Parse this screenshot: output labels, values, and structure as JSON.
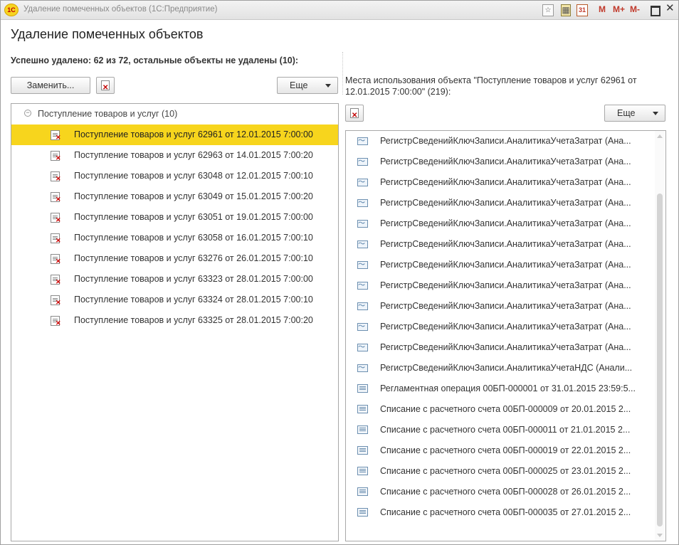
{
  "window": {
    "title": "Удаление помеченных объектов  (1С:Предприятие)",
    "app_logo": "1С",
    "toolbar": {
      "star_icon": "☆",
      "calculator_icon": "▦",
      "calendar_icon": "31",
      "m": "M",
      "m_plus": "M+",
      "m_minus": "M-",
      "close": "✕"
    }
  },
  "page": {
    "title": "Удаление помеченных объектов",
    "summary": "Успешно удалено: 62 из 72, остальные объекты не удалены (10):"
  },
  "left": {
    "replace_button": "Заменить...",
    "more_button": "Еще",
    "group": {
      "label": "Поступление товаров и услуг (10)",
      "collapse_icon": "−"
    },
    "items": [
      {
        "label": "Поступление товаров и услуг 62961 от 12.01.2015 7:00:00",
        "selected": true
      },
      {
        "label": "Поступление товаров и услуг 62963 от 14.01.2015 7:00:20",
        "selected": false
      },
      {
        "label": "Поступление товаров и услуг 63048 от 12.01.2015 7:00:10",
        "selected": false
      },
      {
        "label": "Поступление товаров и услуг 63049 от 15.01.2015 7:00:20",
        "selected": false
      },
      {
        "label": "Поступление товаров и услуг 63051 от 19.01.2015 7:00:00",
        "selected": false
      },
      {
        "label": "Поступление товаров и услуг 63058 от 16.01.2015 7:00:10",
        "selected": false
      },
      {
        "label": "Поступление товаров и услуг 63276 от 26.01.2015 7:00:10",
        "selected": false
      },
      {
        "label": "Поступление товаров и услуг 63323 от 28.01.2015 7:00:00",
        "selected": false
      },
      {
        "label": "Поступление товаров и услуг 63324 от 28.01.2015 7:00:10",
        "selected": false
      },
      {
        "label": "Поступление товаров и услуг 63325 от 28.01.2015 7:00:20",
        "selected": false
      }
    ]
  },
  "right": {
    "caption": "Места использования объекта \"Поступление товаров и услуг 62961 от 12.01.2015 7:00:00\" (219):",
    "more_button": "Еще",
    "items": [
      {
        "label": "РегистрСведенийКлючЗаписи.АналитикаУчетаЗатрат (Ана...",
        "icon": "register-icon"
      },
      {
        "label": "РегистрСведенийКлючЗаписи.АналитикаУчетаЗатрат (Ана...",
        "icon": "register-icon"
      },
      {
        "label": "РегистрСведенийКлючЗаписи.АналитикаУчетаЗатрат (Ана...",
        "icon": "register-icon"
      },
      {
        "label": "РегистрСведенийКлючЗаписи.АналитикаУчетаЗатрат (Ана...",
        "icon": "register-icon"
      },
      {
        "label": "РегистрСведенийКлючЗаписи.АналитикаУчетаЗатрат (Ана...",
        "icon": "register-icon"
      },
      {
        "label": "РегистрСведенийКлючЗаписи.АналитикаУчетаЗатрат (Ана...",
        "icon": "register-icon"
      },
      {
        "label": "РегистрСведенийКлючЗаписи.АналитикаУчетаЗатрат (Ана...",
        "icon": "register-icon"
      },
      {
        "label": "РегистрСведенийКлючЗаписи.АналитикаУчетаЗатрат (Ана...",
        "icon": "register-icon"
      },
      {
        "label": "РегистрСведенийКлючЗаписи.АналитикаУчетаЗатрат (Ана...",
        "icon": "register-icon"
      },
      {
        "label": "РегистрСведенийКлючЗаписи.АналитикаУчетаЗатрат (Ана...",
        "icon": "register-icon"
      },
      {
        "label": "РегистрСведенийКлючЗаписи.АналитикаУчетаЗатрат (Ана...",
        "icon": "register-icon"
      },
      {
        "label": "РегистрСведенийКлючЗаписи.АналитикаУчетаНДС (Анали...",
        "icon": "register-icon"
      },
      {
        "label": "Регламентная операция 00БП-000001 от 31.01.2015 23:59:5...",
        "icon": "document-icon"
      },
      {
        "label": "Списание с расчетного счета 00БП-000009 от 20.01.2015 2...",
        "icon": "document-icon"
      },
      {
        "label": "Списание с расчетного счета 00БП-000011 от 21.01.2015 2...",
        "icon": "document-icon"
      },
      {
        "label": "Списание с расчетного счета 00БП-000019 от 22.01.2015 2...",
        "icon": "document-icon"
      },
      {
        "label": "Списание с расчетного счета 00БП-000025 от 23.01.2015 2...",
        "icon": "document-icon"
      },
      {
        "label": "Списание с расчетного счета 00БП-000028 от 26.01.2015 2...",
        "icon": "document-icon"
      },
      {
        "label": "Списание с расчетного счета 00БП-000035 от 27.01.2015 2...",
        "icon": "document-icon"
      }
    ]
  },
  "colors": {
    "selection": "#f7d51d",
    "accent_red": "#c0392b"
  }
}
